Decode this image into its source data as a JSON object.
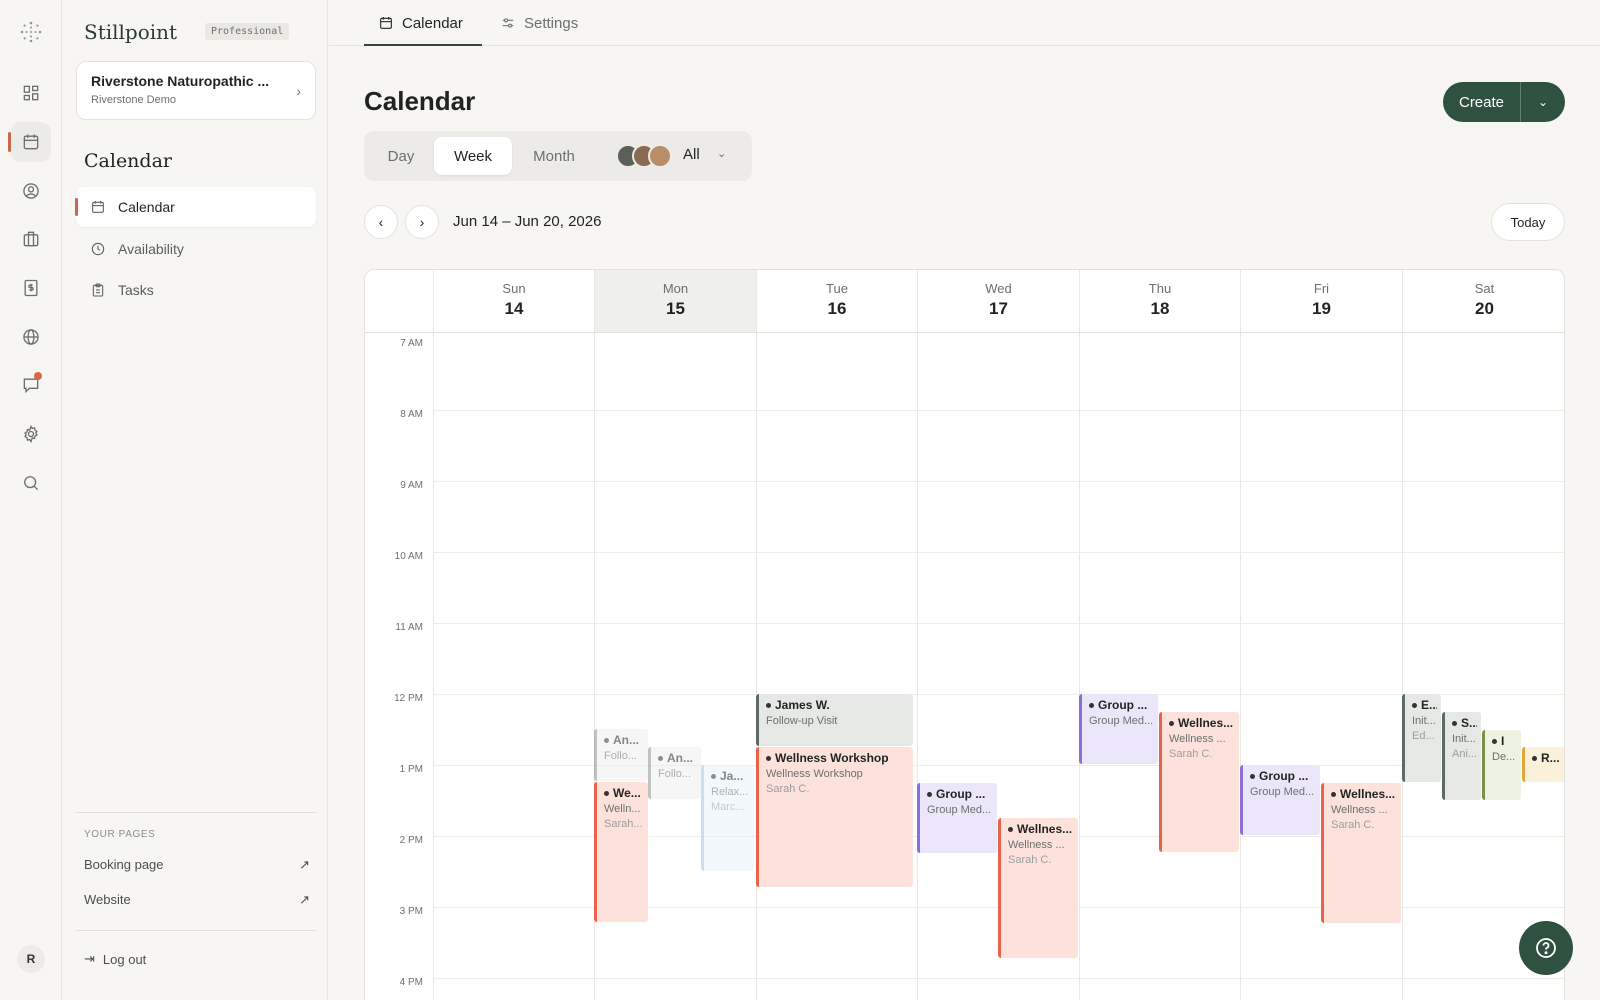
{
  "brand": {
    "name": "Stillpoint",
    "plan": "Professional"
  },
  "org": {
    "name": "Riverstone Naturopathic ...",
    "sub": "Riverstone Demo"
  },
  "rail": {
    "user_initial": "R",
    "icons": [
      "dashboard-icon",
      "calendar-icon",
      "user-icon",
      "briefcase-icon",
      "billing-icon",
      "globe-icon",
      "chat-icon",
      "gear-icon",
      "search-icon"
    ]
  },
  "sidebar": {
    "title": "Calendar",
    "items": [
      {
        "label": "Calendar",
        "icon": "calendar-icon"
      },
      {
        "label": "Availability",
        "icon": "clock-icon"
      },
      {
        "label": "Tasks",
        "icon": "clipboard-icon"
      }
    ],
    "your_pages_label": "YOUR PAGES",
    "pages": [
      {
        "label": "Booking page"
      },
      {
        "label": "Website"
      }
    ],
    "logout_label": "Log out"
  },
  "tabs": [
    {
      "label": "Calendar",
      "icon": "calendar-icon"
    },
    {
      "label": "Settings",
      "icon": "sliders-icon"
    }
  ],
  "page_title": "Calendar",
  "create": {
    "label": "Create"
  },
  "views": [
    "Day",
    "Week",
    "Month"
  ],
  "active_view": "Week",
  "staff_filter": "All",
  "date_range": "Jun 14 – Jun 20, 2026",
  "today_label": "Today",
  "days": [
    {
      "name": "Sun",
      "num": "14"
    },
    {
      "name": "Mon",
      "num": "15"
    },
    {
      "name": "Tue",
      "num": "16"
    },
    {
      "name": "Wed",
      "num": "17"
    },
    {
      "name": "Thu",
      "num": "18"
    },
    {
      "name": "Fri",
      "num": "19"
    },
    {
      "name": "Sat",
      "num": "20"
    }
  ],
  "hours": [
    "7 AM",
    "8 AM",
    "9 AM",
    "10 AM",
    "11 AM",
    "12 PM",
    "1 PM",
    "2 PM",
    "3 PM",
    "4 PM"
  ],
  "events": [
    {
      "t": "An...",
      "s": "Follo...",
      "p": "",
      "fade": true
    },
    {
      "t": "We...",
      "s": "Welln...",
      "p": "Sarah..."
    },
    {
      "t": "An...",
      "s": "Follo...",
      "p": "",
      "fade": true
    },
    {
      "t": "Ja...",
      "s": "Relax...",
      "p": "Marc...",
      "fade": true
    },
    {
      "t": "James W.",
      "s": "Follow-up Visit",
      "p": ""
    },
    {
      "t": "Wellness Workshop",
      "s": "Wellness Workshop",
      "p": "Sarah C."
    },
    {
      "t": "Group ...",
      "s": "Group Med...",
      "p": ""
    },
    {
      "t": "Wellnes...",
      "s": "Wellness ...",
      "p": "Sarah C."
    },
    {
      "t": "Group ...",
      "s": "Group Med...",
      "p": ""
    },
    {
      "t": "Wellnes...",
      "s": "Wellness ...",
      "p": "Sarah C."
    },
    {
      "t": "Group ...",
      "s": "Group Med...",
      "p": ""
    },
    {
      "t": "Wellnes...",
      "s": "Wellness ...",
      "p": "Sarah C."
    },
    {
      "t": "E...",
      "s": "Init...",
      "p": "Ed..."
    },
    {
      "t": "S...",
      "s": "Init...",
      "p": "Ani..."
    },
    {
      "t": "I",
      "s": "De...",
      "p": ""
    },
    {
      "t": "R...",
      "s": "",
      "p": ""
    }
  ],
  "colors": {
    "accent": "#2f5140",
    "active_marker": "#c8694a",
    "event_wellness": "#e8634b",
    "event_group": "#8b6fd6",
    "event_followup": "#5c6b63",
    "event_relax": "#9cc7e3",
    "event_intake": "#7a8f4a",
    "event_other": "#e0a63a"
  }
}
